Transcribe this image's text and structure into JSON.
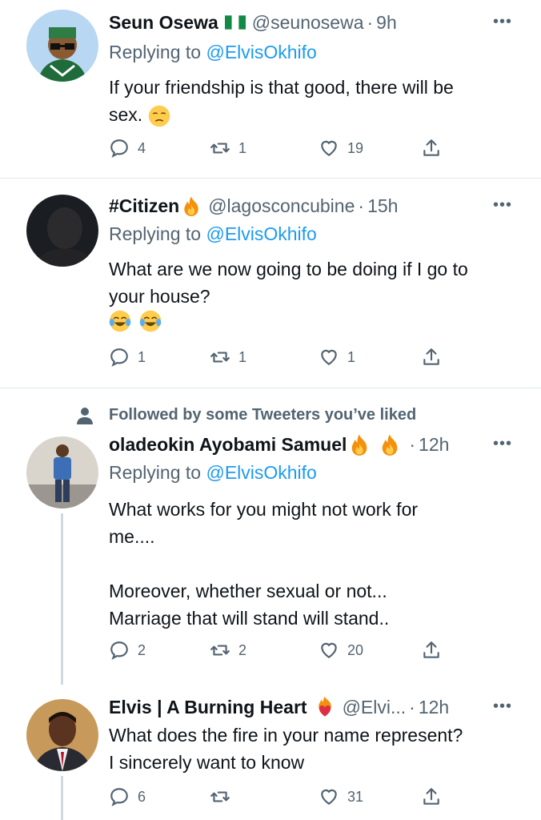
{
  "tweets": [
    {
      "name": "Seun Osewa",
      "handle": "@seunosewa",
      "time": "9h",
      "replying_prefix": "Replying to ",
      "replying_to": "@ElvisOkhifo",
      "text": "If your friendship is that good, there will be\nsex.",
      "replies": "4",
      "retweets": "1",
      "likes": "19"
    },
    {
      "name": "#Citizen",
      "handle": "@lagosconcubine",
      "time": "15h",
      "replying_prefix": "Replying to ",
      "replying_to": "@ElvisOkhifo",
      "text": "What are we now going to be doing if I go to\nyour house?",
      "replies": "1",
      "retweets": "1",
      "likes": "1"
    },
    {
      "social_context": "Followed by some Tweeters you’ve liked",
      "name": "oladeokin Ayobami Samuel",
      "handle": "",
      "time": "12h",
      "replying_prefix": "Replying to ",
      "replying_to": "@ElvisOkhifo",
      "text": "What works for you might not work for\nme....\n\nMoreover, whether sexual or not...\nMarriage that will stand will stand..",
      "replies": "2",
      "retweets": "2",
      "likes": "20"
    },
    {
      "name": "Elvis | A Burning Heart",
      "handle": "@Elvi...",
      "time": "12h",
      "text": "What does the fire in your name represent?\nI sincerely want to know",
      "replies": "6",
      "retweets": "",
      "likes": "31"
    }
  ],
  "dot": "·",
  "more": "•••",
  "colors": {
    "link": "#1d9bf0",
    "secondary": "#536471",
    "text": "#0f1419"
  }
}
